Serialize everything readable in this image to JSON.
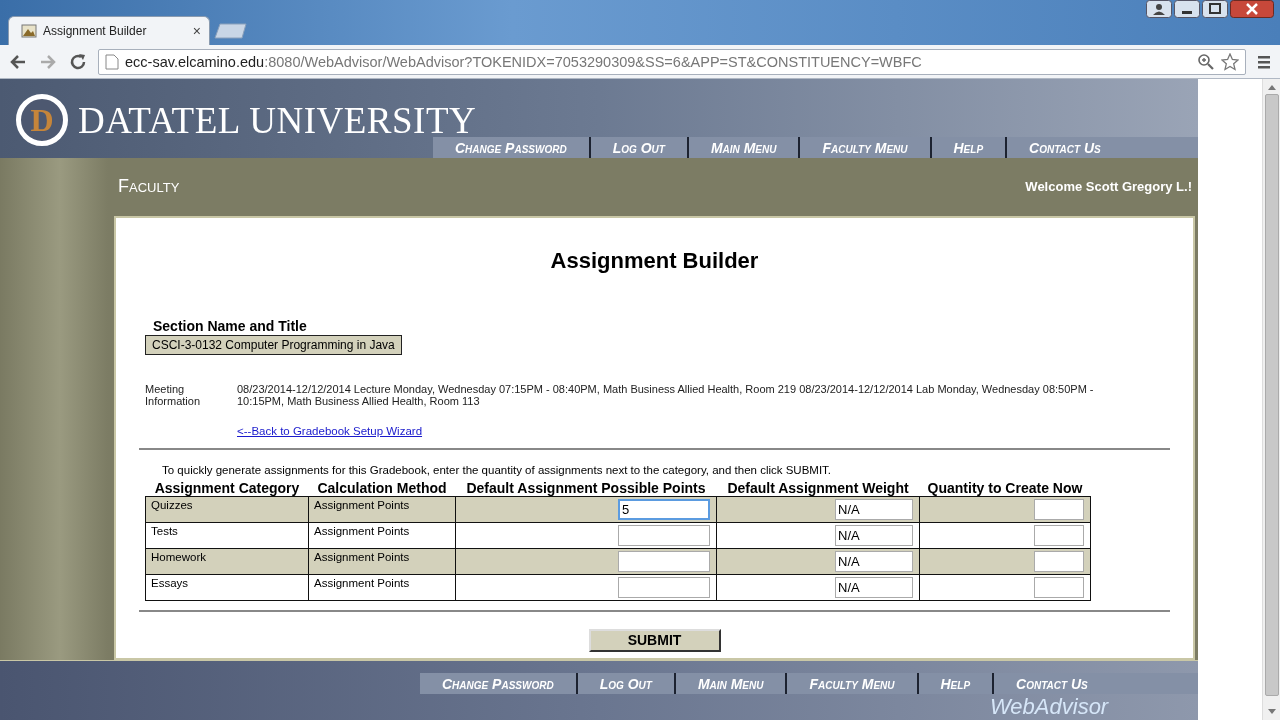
{
  "browser": {
    "tab": {
      "title": "Assignment Builder",
      "close": "×"
    },
    "url": {
      "host": "ecc-sav.elcamino.edu",
      "path": ":8080/WebAdvisor/WebAdvisor?TOKENIDX=7053290309&SS=6&APP=ST&CONSTITUENCY=WBFC"
    }
  },
  "header": {
    "logo_letter": "D",
    "university": "DATATEL UNIVERSITY",
    "nav": [
      "Change Password",
      "Log Out",
      "Main Menu",
      "Faculty Menu",
      "Help",
      "Contact Us"
    ]
  },
  "faculty_bar": {
    "title": "Faculty",
    "welcome": "Welcome Scott Gregory L.!"
  },
  "content": {
    "title": "Assignment Builder",
    "section_label": "Section Name and Title",
    "section_value": "CSCI-3-0132 Computer Programming in Java",
    "meeting_label": "Meeting Information",
    "meeting_text": "08/23/2014-12/12/2014 Lecture Monday, Wednesday 07:15PM - 08:40PM, Math Business Allied Health, Room 219 08/23/2014-12/12/2014 Lab Monday, Wednesday 08:50PM - 10:15PM, Math Business Allied Health, Room 113",
    "back_link": "<--Back to Gradebook Setup Wizard",
    "instructions": "To quickly generate assignments for this Gradebook, enter the quantity of assignments next to the category, and then click SUBMIT.",
    "table": {
      "columns": [
        "Assignment Category",
        "Calculation Method",
        "Default Assignment Possible Points",
        "Default Assignment Weight",
        "Quantity to Create Now"
      ],
      "rows": [
        {
          "category": "Quizzes",
          "method": "Assignment Points",
          "points": "5",
          "weight": "N/A",
          "focused": true
        },
        {
          "category": "Tests",
          "method": "Assignment Points",
          "weight": "N/A",
          "focused": false
        },
        {
          "category": "Homework",
          "method": "Assignment Points",
          "weight": "N/A",
          "focused": false
        },
        {
          "category": "Essays",
          "method": "Assignment Points",
          "weight": "N/A",
          "focused": false
        }
      ]
    },
    "submit": "SUBMIT"
  },
  "footer": {
    "nav": [
      "Change Password",
      "Log Out",
      "Main Menu",
      "Faculty Menu",
      "Help",
      "Contact Us"
    ],
    "logo": "WebAdvisor"
  }
}
